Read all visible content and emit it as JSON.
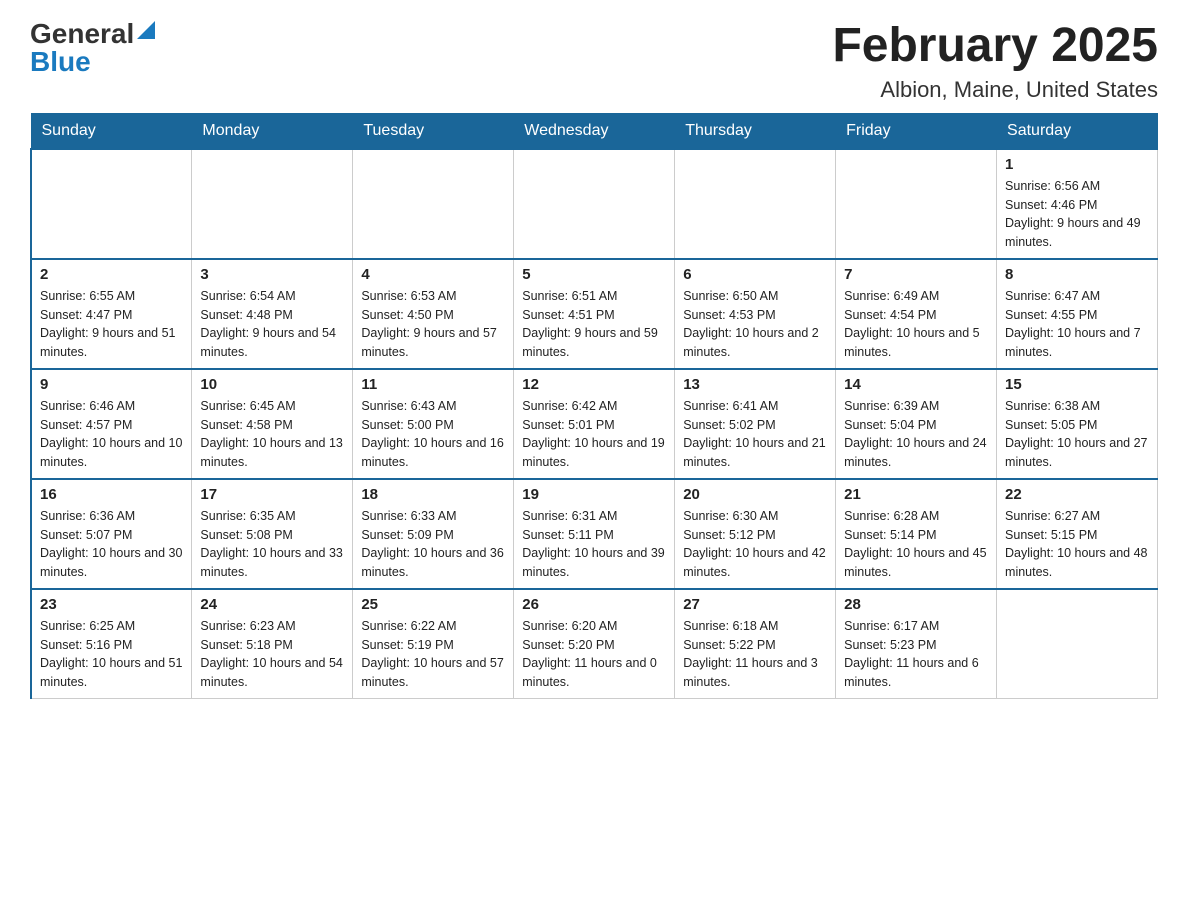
{
  "header": {
    "logo": {
      "general": "General",
      "blue": "Blue"
    },
    "title": "February 2025",
    "location": "Albion, Maine, United States"
  },
  "days_of_week": [
    "Sunday",
    "Monday",
    "Tuesday",
    "Wednesday",
    "Thursday",
    "Friday",
    "Saturday"
  ],
  "weeks": [
    [
      {
        "day": "",
        "info": ""
      },
      {
        "day": "",
        "info": ""
      },
      {
        "day": "",
        "info": ""
      },
      {
        "day": "",
        "info": ""
      },
      {
        "day": "",
        "info": ""
      },
      {
        "day": "",
        "info": ""
      },
      {
        "day": "1",
        "info": "Sunrise: 6:56 AM\nSunset: 4:46 PM\nDaylight: 9 hours and 49 minutes."
      }
    ],
    [
      {
        "day": "2",
        "info": "Sunrise: 6:55 AM\nSunset: 4:47 PM\nDaylight: 9 hours and 51 minutes."
      },
      {
        "day": "3",
        "info": "Sunrise: 6:54 AM\nSunset: 4:48 PM\nDaylight: 9 hours and 54 minutes."
      },
      {
        "day": "4",
        "info": "Sunrise: 6:53 AM\nSunset: 4:50 PM\nDaylight: 9 hours and 57 minutes."
      },
      {
        "day": "5",
        "info": "Sunrise: 6:51 AM\nSunset: 4:51 PM\nDaylight: 9 hours and 59 minutes."
      },
      {
        "day": "6",
        "info": "Sunrise: 6:50 AM\nSunset: 4:53 PM\nDaylight: 10 hours and 2 minutes."
      },
      {
        "day": "7",
        "info": "Sunrise: 6:49 AM\nSunset: 4:54 PM\nDaylight: 10 hours and 5 minutes."
      },
      {
        "day": "8",
        "info": "Sunrise: 6:47 AM\nSunset: 4:55 PM\nDaylight: 10 hours and 7 minutes."
      }
    ],
    [
      {
        "day": "9",
        "info": "Sunrise: 6:46 AM\nSunset: 4:57 PM\nDaylight: 10 hours and 10 minutes."
      },
      {
        "day": "10",
        "info": "Sunrise: 6:45 AM\nSunset: 4:58 PM\nDaylight: 10 hours and 13 minutes."
      },
      {
        "day": "11",
        "info": "Sunrise: 6:43 AM\nSunset: 5:00 PM\nDaylight: 10 hours and 16 minutes."
      },
      {
        "day": "12",
        "info": "Sunrise: 6:42 AM\nSunset: 5:01 PM\nDaylight: 10 hours and 19 minutes."
      },
      {
        "day": "13",
        "info": "Sunrise: 6:41 AM\nSunset: 5:02 PM\nDaylight: 10 hours and 21 minutes."
      },
      {
        "day": "14",
        "info": "Sunrise: 6:39 AM\nSunset: 5:04 PM\nDaylight: 10 hours and 24 minutes."
      },
      {
        "day": "15",
        "info": "Sunrise: 6:38 AM\nSunset: 5:05 PM\nDaylight: 10 hours and 27 minutes."
      }
    ],
    [
      {
        "day": "16",
        "info": "Sunrise: 6:36 AM\nSunset: 5:07 PM\nDaylight: 10 hours and 30 minutes."
      },
      {
        "day": "17",
        "info": "Sunrise: 6:35 AM\nSunset: 5:08 PM\nDaylight: 10 hours and 33 minutes."
      },
      {
        "day": "18",
        "info": "Sunrise: 6:33 AM\nSunset: 5:09 PM\nDaylight: 10 hours and 36 minutes."
      },
      {
        "day": "19",
        "info": "Sunrise: 6:31 AM\nSunset: 5:11 PM\nDaylight: 10 hours and 39 minutes."
      },
      {
        "day": "20",
        "info": "Sunrise: 6:30 AM\nSunset: 5:12 PM\nDaylight: 10 hours and 42 minutes."
      },
      {
        "day": "21",
        "info": "Sunrise: 6:28 AM\nSunset: 5:14 PM\nDaylight: 10 hours and 45 minutes."
      },
      {
        "day": "22",
        "info": "Sunrise: 6:27 AM\nSunset: 5:15 PM\nDaylight: 10 hours and 48 minutes."
      }
    ],
    [
      {
        "day": "23",
        "info": "Sunrise: 6:25 AM\nSunset: 5:16 PM\nDaylight: 10 hours and 51 minutes."
      },
      {
        "day": "24",
        "info": "Sunrise: 6:23 AM\nSunset: 5:18 PM\nDaylight: 10 hours and 54 minutes."
      },
      {
        "day": "25",
        "info": "Sunrise: 6:22 AM\nSunset: 5:19 PM\nDaylight: 10 hours and 57 minutes."
      },
      {
        "day": "26",
        "info": "Sunrise: 6:20 AM\nSunset: 5:20 PM\nDaylight: 11 hours and 0 minutes."
      },
      {
        "day": "27",
        "info": "Sunrise: 6:18 AM\nSunset: 5:22 PM\nDaylight: 11 hours and 3 minutes."
      },
      {
        "day": "28",
        "info": "Sunrise: 6:17 AM\nSunset: 5:23 PM\nDaylight: 11 hours and 6 minutes."
      },
      {
        "day": "",
        "info": ""
      }
    ]
  ]
}
